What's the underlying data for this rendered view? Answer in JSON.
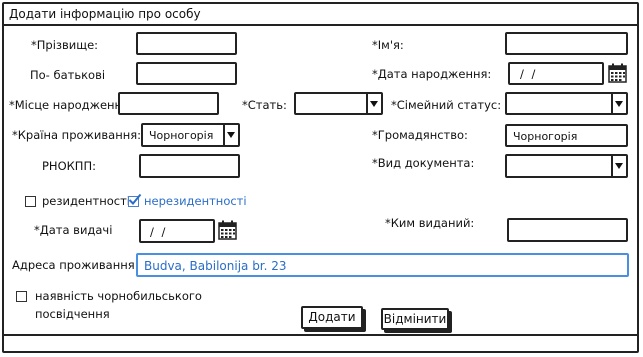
{
  "window": {
    "title": "Додати інформацію про особу"
  },
  "labels": {
    "surname": "*Прізвище:",
    "name": "*Ім'я:",
    "patronymic": "По- батькові",
    "birth_date": "*Дата народження:",
    "birth_place": "*Місце народження:",
    "sex": "*Стать:",
    "marital_status": "*Сімейний статус:",
    "country": "*Країна проживання:",
    "citizenship": "*Громадянство:",
    "rnokpp": "РНОКПП:",
    "doc_type": "*Вид документа:",
    "resident": "резидентності",
    "nonresident": "нерезидентності",
    "issue_date": "*Дата видачі",
    "issued_by": "*Ким виданий:",
    "address": "Адреса проживання:",
    "chernobyl_line1": "наявність чорнобильського",
    "chernobyl_line2": "посвідчення"
  },
  "values": {
    "surname": "",
    "name": "",
    "patronymic": "",
    "birth_date": "/ /",
    "birth_place": "",
    "sex": "",
    "marital_status": "",
    "country": "Чорногорія",
    "citizenship": "Чорногорія",
    "rnokpp": "",
    "doc_type": "",
    "issue_date": "/ /",
    "issued_by": "",
    "address": "Budva, Babilonija br. 23"
  },
  "checkboxes": {
    "resident": false,
    "nonresident": true,
    "chernobyl": false
  },
  "buttons": {
    "add": "Додати",
    "cancel": "Відмінити"
  },
  "icons": {
    "calendar": "calendar-icon",
    "dropdown": "chevron-down-icon",
    "checkmark": "checkmark-icon"
  },
  "colors": {
    "accent": "#2a6dc8",
    "focus_border": "#4a90e2"
  }
}
